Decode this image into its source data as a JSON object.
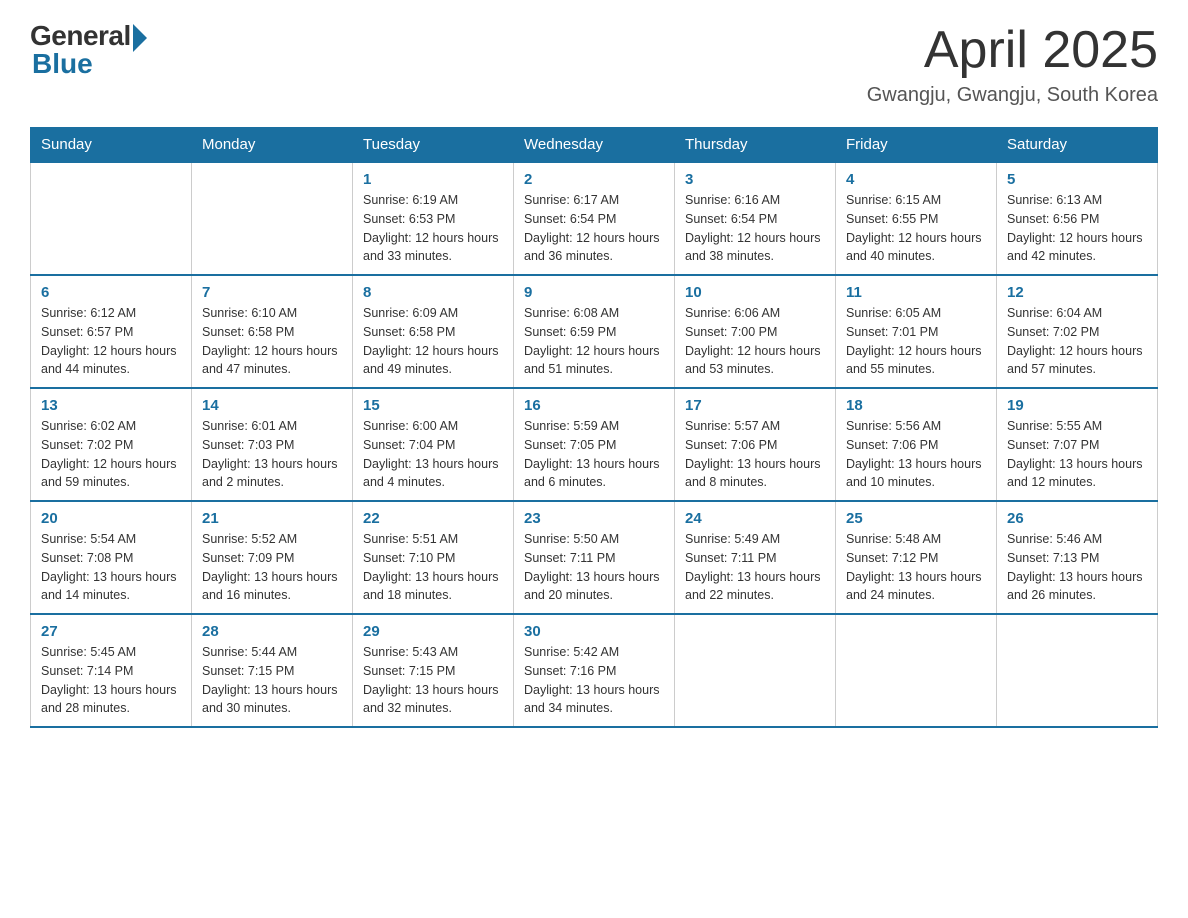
{
  "header": {
    "logo_general": "General",
    "logo_blue": "Blue",
    "title": "April 2025",
    "subtitle": "Gwangju, Gwangju, South Korea"
  },
  "days_of_week": [
    "Sunday",
    "Monday",
    "Tuesday",
    "Wednesday",
    "Thursday",
    "Friday",
    "Saturday"
  ],
  "weeks": [
    [
      null,
      null,
      {
        "day": "1",
        "sunrise": "6:19 AM",
        "sunset": "6:53 PM",
        "daylight": "12 hours and 33 minutes."
      },
      {
        "day": "2",
        "sunrise": "6:17 AM",
        "sunset": "6:54 PM",
        "daylight": "12 hours and 36 minutes."
      },
      {
        "day": "3",
        "sunrise": "6:16 AM",
        "sunset": "6:54 PM",
        "daylight": "12 hours and 38 minutes."
      },
      {
        "day": "4",
        "sunrise": "6:15 AM",
        "sunset": "6:55 PM",
        "daylight": "12 hours and 40 minutes."
      },
      {
        "day": "5",
        "sunrise": "6:13 AM",
        "sunset": "6:56 PM",
        "daylight": "12 hours and 42 minutes."
      }
    ],
    [
      {
        "day": "6",
        "sunrise": "6:12 AM",
        "sunset": "6:57 PM",
        "daylight": "12 hours and 44 minutes."
      },
      {
        "day": "7",
        "sunrise": "6:10 AM",
        "sunset": "6:58 PM",
        "daylight": "12 hours and 47 minutes."
      },
      {
        "day": "8",
        "sunrise": "6:09 AM",
        "sunset": "6:58 PM",
        "daylight": "12 hours and 49 minutes."
      },
      {
        "day": "9",
        "sunrise": "6:08 AM",
        "sunset": "6:59 PM",
        "daylight": "12 hours and 51 minutes."
      },
      {
        "day": "10",
        "sunrise": "6:06 AM",
        "sunset": "7:00 PM",
        "daylight": "12 hours and 53 minutes."
      },
      {
        "day": "11",
        "sunrise": "6:05 AM",
        "sunset": "7:01 PM",
        "daylight": "12 hours and 55 minutes."
      },
      {
        "day": "12",
        "sunrise": "6:04 AM",
        "sunset": "7:02 PM",
        "daylight": "12 hours and 57 minutes."
      }
    ],
    [
      {
        "day": "13",
        "sunrise": "6:02 AM",
        "sunset": "7:02 PM",
        "daylight": "12 hours and 59 minutes."
      },
      {
        "day": "14",
        "sunrise": "6:01 AM",
        "sunset": "7:03 PM",
        "daylight": "13 hours and 2 minutes."
      },
      {
        "day": "15",
        "sunrise": "6:00 AM",
        "sunset": "7:04 PM",
        "daylight": "13 hours and 4 minutes."
      },
      {
        "day": "16",
        "sunrise": "5:59 AM",
        "sunset": "7:05 PM",
        "daylight": "13 hours and 6 minutes."
      },
      {
        "day": "17",
        "sunrise": "5:57 AM",
        "sunset": "7:06 PM",
        "daylight": "13 hours and 8 minutes."
      },
      {
        "day": "18",
        "sunrise": "5:56 AM",
        "sunset": "7:06 PM",
        "daylight": "13 hours and 10 minutes."
      },
      {
        "day": "19",
        "sunrise": "5:55 AM",
        "sunset": "7:07 PM",
        "daylight": "13 hours and 12 minutes."
      }
    ],
    [
      {
        "day": "20",
        "sunrise": "5:54 AM",
        "sunset": "7:08 PM",
        "daylight": "13 hours and 14 minutes."
      },
      {
        "day": "21",
        "sunrise": "5:52 AM",
        "sunset": "7:09 PM",
        "daylight": "13 hours and 16 minutes."
      },
      {
        "day": "22",
        "sunrise": "5:51 AM",
        "sunset": "7:10 PM",
        "daylight": "13 hours and 18 minutes."
      },
      {
        "day": "23",
        "sunrise": "5:50 AM",
        "sunset": "7:11 PM",
        "daylight": "13 hours and 20 minutes."
      },
      {
        "day": "24",
        "sunrise": "5:49 AM",
        "sunset": "7:11 PM",
        "daylight": "13 hours and 22 minutes."
      },
      {
        "day": "25",
        "sunrise": "5:48 AM",
        "sunset": "7:12 PM",
        "daylight": "13 hours and 24 minutes."
      },
      {
        "day": "26",
        "sunrise": "5:46 AM",
        "sunset": "7:13 PM",
        "daylight": "13 hours and 26 minutes."
      }
    ],
    [
      {
        "day": "27",
        "sunrise": "5:45 AM",
        "sunset": "7:14 PM",
        "daylight": "13 hours and 28 minutes."
      },
      {
        "day": "28",
        "sunrise": "5:44 AM",
        "sunset": "7:15 PM",
        "daylight": "13 hours and 30 minutes."
      },
      {
        "day": "29",
        "sunrise": "5:43 AM",
        "sunset": "7:15 PM",
        "daylight": "13 hours and 32 minutes."
      },
      {
        "day": "30",
        "sunrise": "5:42 AM",
        "sunset": "7:16 PM",
        "daylight": "13 hours and 34 minutes."
      },
      null,
      null,
      null
    ]
  ],
  "labels": {
    "sunrise": "Sunrise:",
    "sunset": "Sunset:",
    "daylight": "Daylight:"
  }
}
